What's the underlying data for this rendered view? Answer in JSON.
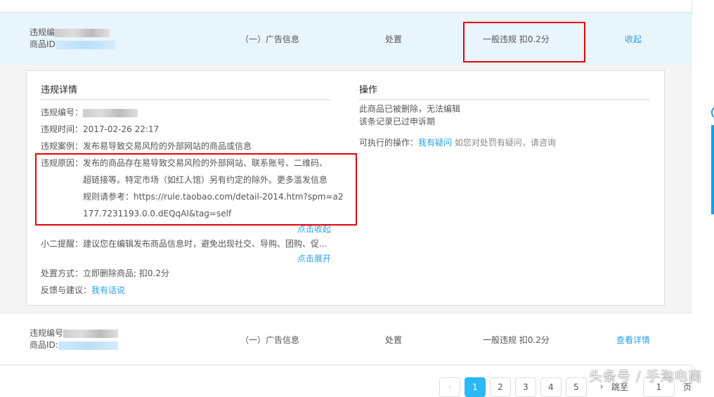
{
  "row1": {
    "violation_no_label": "违规编",
    "product_id_label": "商品ID",
    "category": "（一）广告信息",
    "action": "处置",
    "penalty": "一般违规 扣0.2分",
    "toggle": "收起"
  },
  "detail": {
    "title": "违规详情",
    "no_label": "违规编号：",
    "time_label": "违规时间：",
    "time": "2017-02-26 22:17",
    "case_label": "违规案例：",
    "case": "发布易导致交易风险的外部网站的商品或信息",
    "reason_label": "违规原因：",
    "reason_lines": [
      "发布的商品存在易导致交易风险的外部网站、联系账号、二维码、",
      "超链接等。特定市场（如红人馆）另有约定的除外。更多滥发信息",
      "规则请参考：https://rule.taobao.com/detail-2014.htm?spm=a2",
      "177.7231193.0.0.dEQqAI&tag=self"
    ],
    "collapse": "点击收起",
    "tip_label": "小二提醒：",
    "tip": "建议您在编辑发布商品信息时，避免出现社交、导购、团购、促...",
    "expand": "点击展开",
    "method_label": "处置方式：",
    "method": "立即删除商品; 扣0.2分",
    "feedback_label": "反馈与建议：",
    "feedback_link": "我有话说"
  },
  "operation": {
    "title": "操作",
    "line1": "此商品已被删除，无法编辑",
    "line2": "该条记录已过申诉期",
    "available_label": "可执行的操作：",
    "question_link": "我有疑问",
    "question_hint": "如您对处罚有疑问，请咨询"
  },
  "row2": {
    "violation_no_label": "违规编号",
    "product_id_label": "商品ID:",
    "category": "（一）广告信息",
    "action": "处置",
    "penalty": "一般违规 扣0.2分",
    "detail_link": "查看详情"
  },
  "pagination": {
    "prev": "‹",
    "pages": [
      "1",
      "2",
      "3",
      "4",
      "5"
    ],
    "next": "›",
    "goto_label": "跳至",
    "goto_value": "1",
    "page_unit": "页"
  },
  "watermark": "头条号 / 手淘电商",
  "colors": {
    "accent": "#29a0e6",
    "highlight": "#e8f5fc",
    "annotation": "#e8000b"
  }
}
